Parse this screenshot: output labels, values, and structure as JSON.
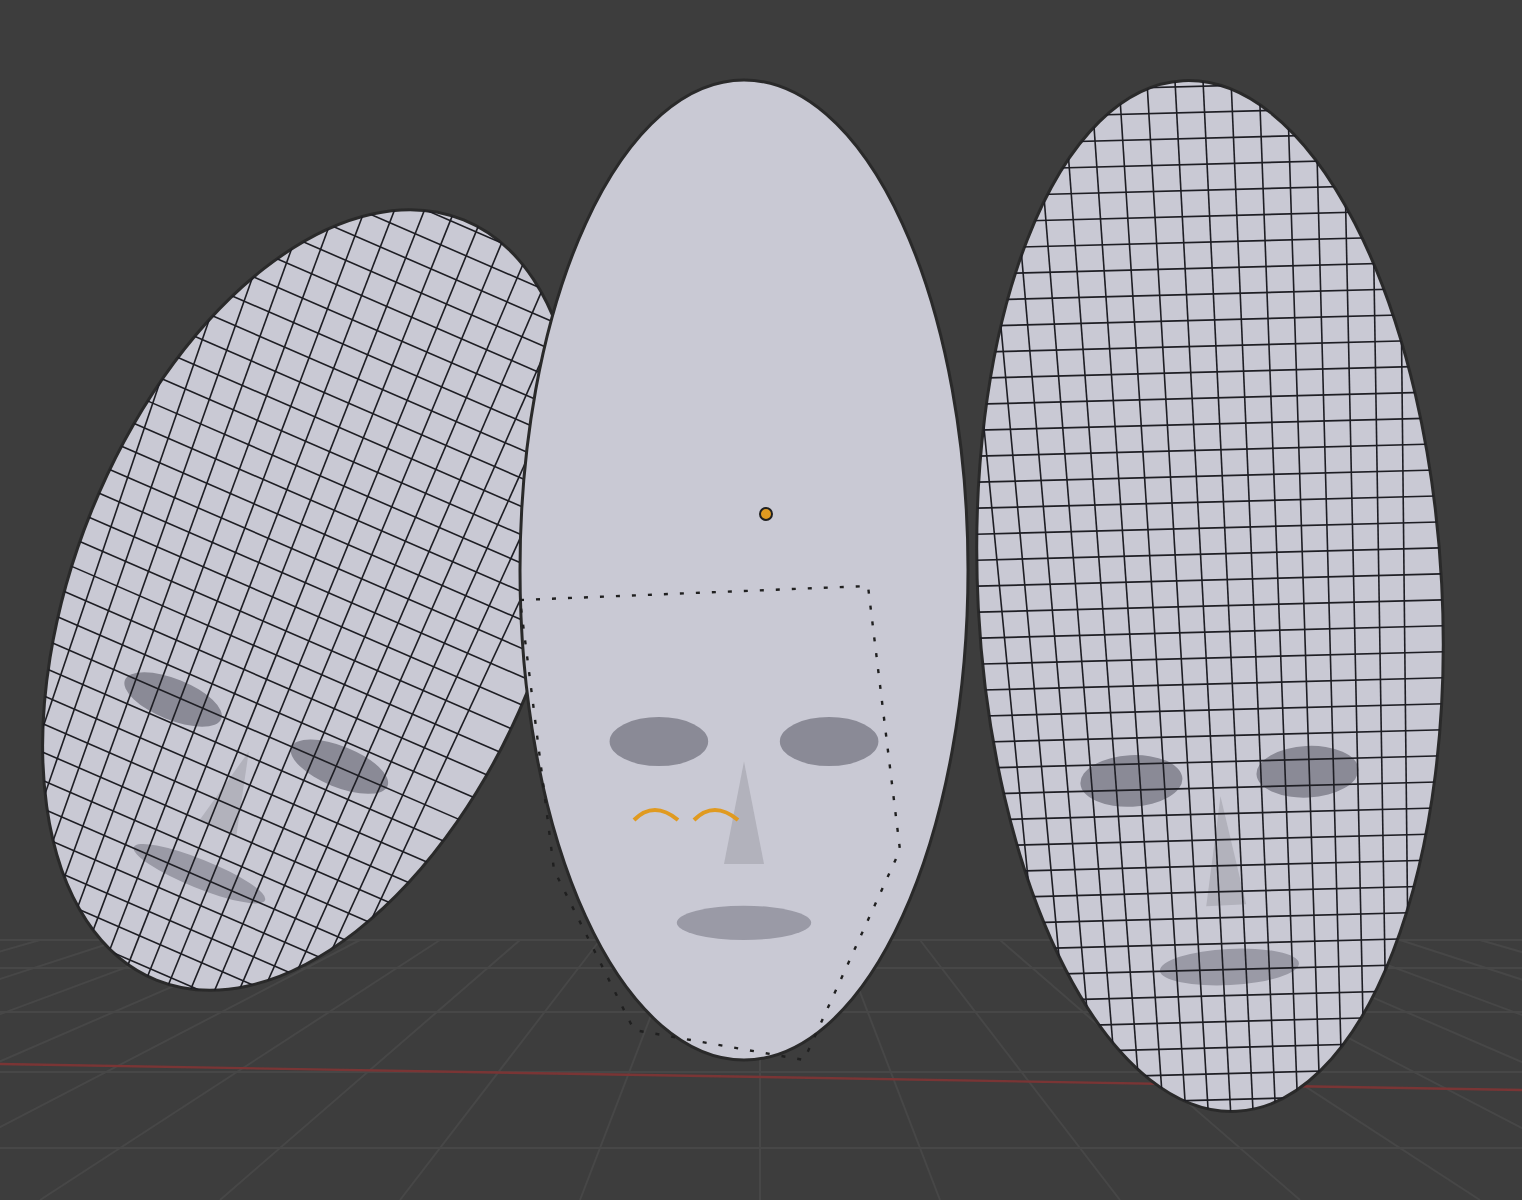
{
  "viewport": {
    "models": [
      {
        "kind": "wireframe"
      },
      {
        "kind": "sculpt"
      },
      {
        "kind": "wireframe"
      }
    ]
  }
}
